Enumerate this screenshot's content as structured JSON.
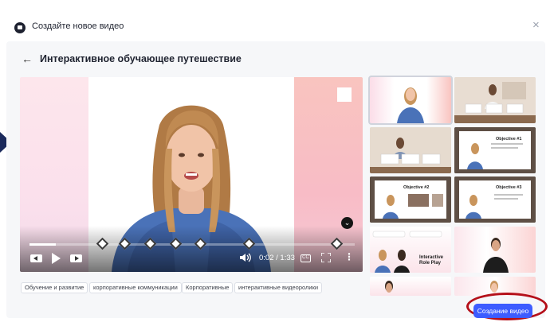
{
  "dialog": {
    "title": "Создайте новое видео",
    "close_symbol": "×"
  },
  "template": {
    "back_symbol": "←",
    "title": "Интерактивное обучающее путешествие"
  },
  "player": {
    "time": "0:02 / 1:33",
    "progress_fraction": 0.08,
    "cc_label": "CC",
    "more_symbol": "⋮",
    "scroll_symbol": "⌄"
  },
  "thumbnails": {
    "t3": {
      "title": "Objective #1"
    },
    "t5": {
      "title": "Objective #2"
    },
    "t6": {
      "title": "Objective #3"
    },
    "t7": {
      "title": "Interactive Role Play"
    }
  },
  "tags": [
    "Обучение и развитие",
    "корпоративные коммуникации",
    "Корпоративные",
    "интерактивные видеоролики"
  ],
  "actions": {
    "create_label": "Создание видео"
  },
  "colors": {
    "accent": "#3d5cff",
    "highlight_ring": "#b5101a",
    "edge_arrow": "#1b2a5c"
  }
}
